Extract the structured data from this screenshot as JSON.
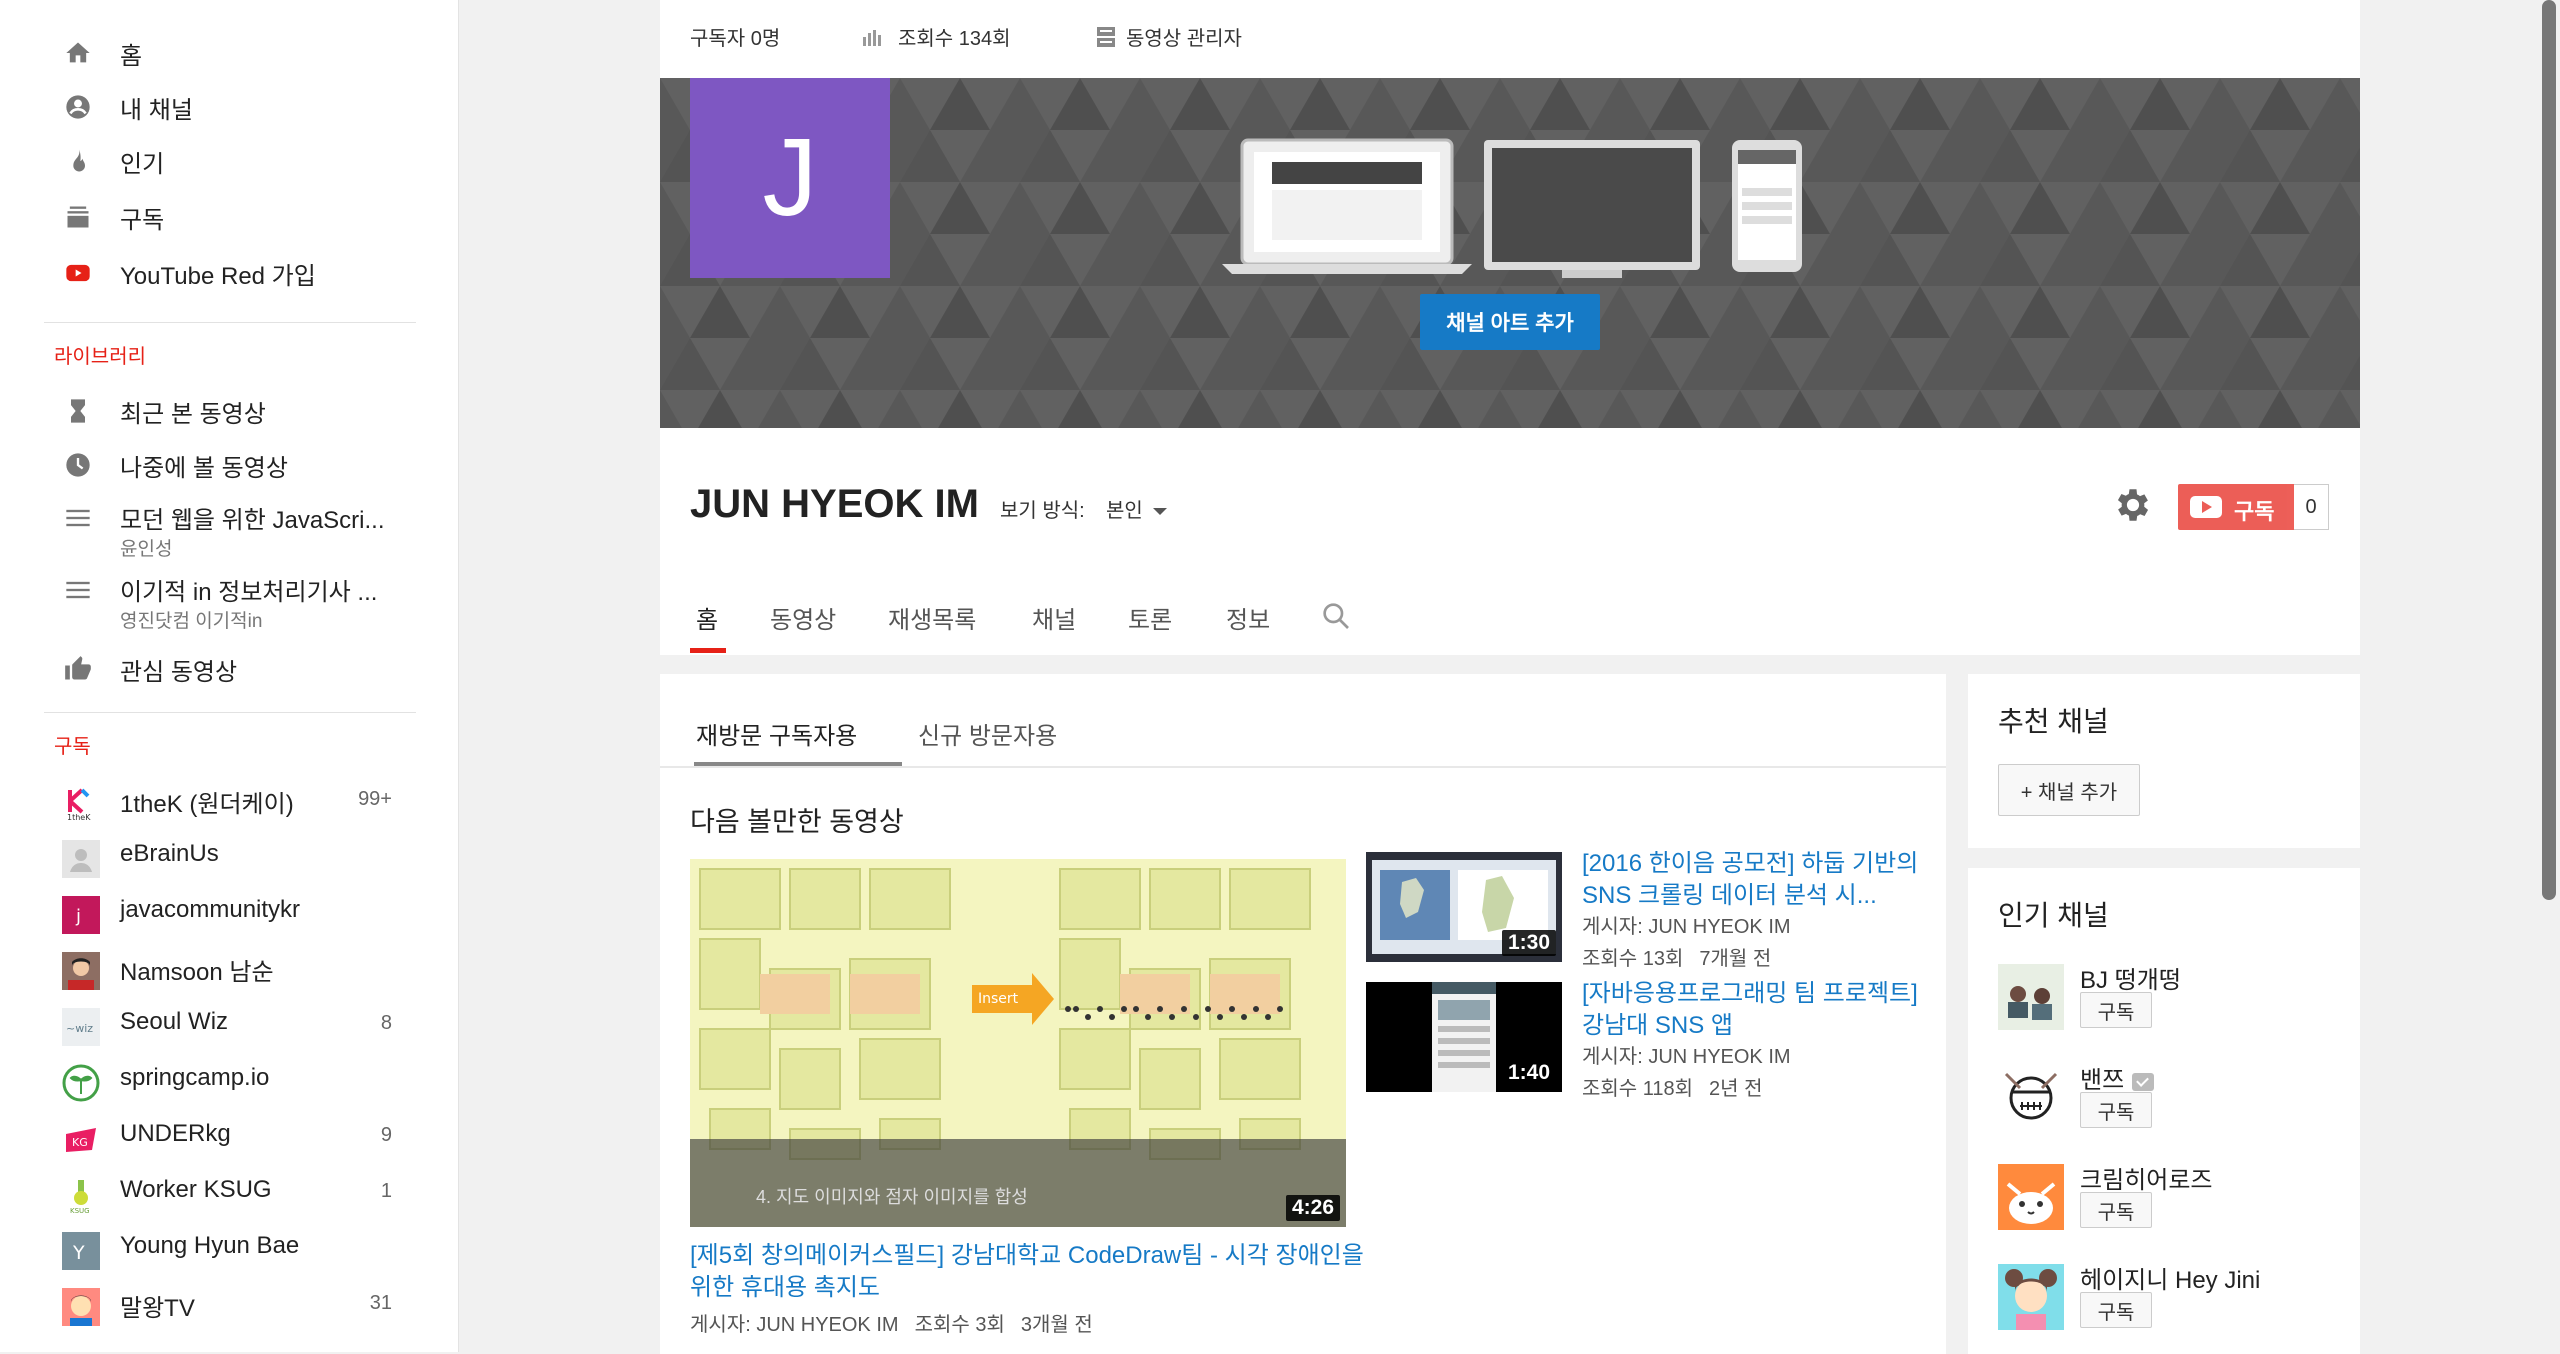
{
  "sidebar": {
    "nav": [
      {
        "label": "홈",
        "icon": "home-icon"
      },
      {
        "label": "내 채널",
        "icon": "account-icon"
      },
      {
        "label": "인기",
        "icon": "fire-icon"
      },
      {
        "label": "구독",
        "icon": "subscriptions-icon"
      },
      {
        "label": "YouTube Red 가입",
        "icon": "youtube-red-icon"
      }
    ],
    "library_heading": "라이브러리",
    "library": [
      {
        "label": "최근 본 동영상",
        "icon": "history-icon"
      },
      {
        "label": "나중에 볼 동영상",
        "icon": "watch-later-icon"
      },
      {
        "label": "모던 웹을 위한 JavaScri...",
        "sub": "윤인성",
        "icon": "playlist-icon"
      },
      {
        "label": "이기적 in 정보처리기사 ...",
        "sub": "영진닷컴 이기적in",
        "icon": "playlist-icon"
      },
      {
        "label": "관심 동영상",
        "icon": "thumbs-up-icon"
      }
    ],
    "subscriptions_heading": "구독",
    "subscriptions": [
      {
        "label": "1theK (원더케이)",
        "count": "99+"
      },
      {
        "label": "eBrainUs",
        "count": ""
      },
      {
        "label": "javacommunitykr",
        "count": ""
      },
      {
        "label": "Namsoon 남순",
        "count": ""
      },
      {
        "label": "Seoul Wiz",
        "count": "8"
      },
      {
        "label": "springcamp.io",
        "count": ""
      },
      {
        "label": "UNDERkg",
        "count": "9"
      },
      {
        "label": "Worker KSUG",
        "count": "1"
      },
      {
        "label": "Young Hyun Bae",
        "count": ""
      },
      {
        "label": "말왕TV",
        "count": "31"
      }
    ]
  },
  "channel": {
    "stats": {
      "subscribers": "구독자 0명",
      "views": "조회수 134회",
      "video_manager": "동영상 관리자"
    },
    "avatar_letter": "J",
    "add_art": "채널 아트 추가",
    "name": "JUN HYEOK IM",
    "view_as_label": "보기 방식:",
    "view_as_value": "본인",
    "subscribe_label": "구독",
    "subscriber_count": "0",
    "tabs": [
      "홈",
      "동영상",
      "재생목록",
      "채널",
      "토론",
      "정보"
    ],
    "accent": "#e62117",
    "link_color": "#167ac6"
  },
  "content": {
    "subtabs": [
      "재방문 구독자용",
      "신규 방문자용"
    ],
    "section_title": "다음 볼만한 동영상",
    "main_video": {
      "title": "[제5회 창의메이커스필드] 강남대학교 CodeDraw팀 - 시각 장애인을 위한 휴대용 촉지도",
      "uploader": "게시자: JUN HYEOK IM",
      "views": "조회수 3회",
      "age": "3개월 전",
      "duration": "4:26",
      "caption": "4. 지도 이미지와 점자 이미지를 합성",
      "insert_label": "Insert"
    },
    "side_videos": [
      {
        "title": "[2016 한이음 공모전] 하둡 기반의 SNS 크롤링 데이터 분석 시...",
        "uploader": "게시자: JUN HYEOK IM",
        "views": "조회수 13회",
        "age": "7개월 전",
        "duration": "1:30"
      },
      {
        "title": "[자바응용프로그래밍 팀 프로젝트] 강남대 SNS 앱",
        "uploader": "게시자: JUN HYEOK IM",
        "views": "조회수 118회",
        "age": "2년 전",
        "duration": "1:40"
      }
    ]
  },
  "recommended": {
    "title": "추천 채널",
    "add_button": "+ 채널 추가"
  },
  "popular": {
    "title": "인기 채널",
    "subscribe_label": "구독",
    "channels": [
      {
        "name": "BJ 떵개떵",
        "verified": false
      },
      {
        "name": "밴쯔",
        "verified": true
      },
      {
        "name": "크림히어로즈",
        "verified": false
      },
      {
        "name": "헤이지니 Hey Jini",
        "verified": false
      }
    ]
  }
}
